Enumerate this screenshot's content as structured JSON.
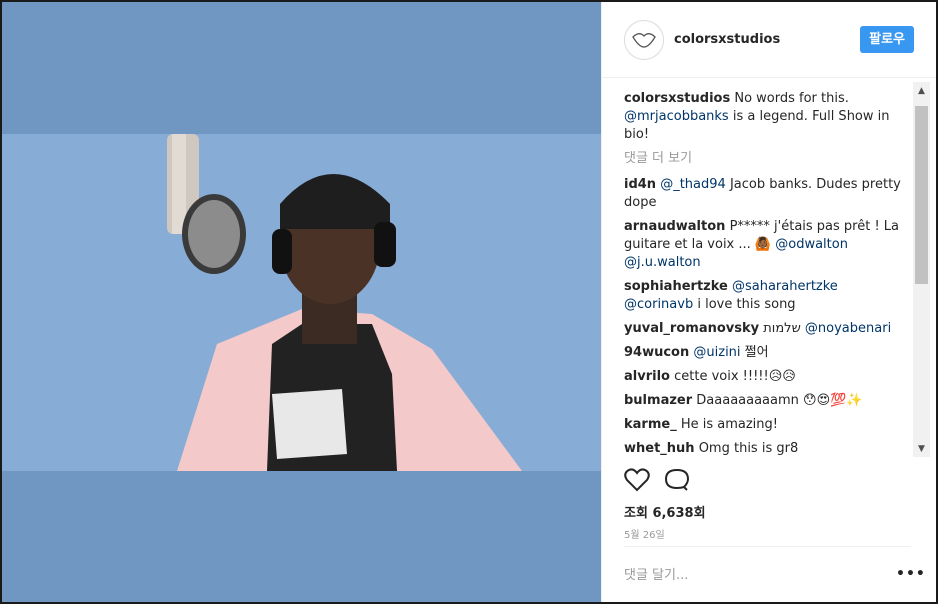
{
  "header": {
    "handle": "colorsxstudios",
    "follow_label": "팔로우"
  },
  "caption": {
    "user": "colorsxstudios",
    "text": "No words for this.",
    "mention": "@mrjacobbanks",
    "text2": "is a legend. Full Show in bio!"
  },
  "more_comments": "댓글 더 보기",
  "comments": [
    {
      "user": "id4n",
      "mention": "@_thad94",
      "text": "Jacob banks. Dudes pretty dope"
    },
    {
      "user": "arnaudwalton",
      "text": "P***** j'étais pas prêt ! La guitare et la voix ... 🙆🏾",
      "mention": "@odwalton",
      "mention2": "@j.u.walton"
    },
    {
      "user": "sophiahertzke",
      "mention": "@saharahertzke",
      "mention2": "@corinavb",
      "text": "i love this song"
    },
    {
      "user": "yuval_romanovsky",
      "text": "שלמות",
      "mention": "@noyabenari"
    },
    {
      "user": "94wucon",
      "mention": "@uizini",
      "text": "쩔어"
    },
    {
      "user": "alvrilo",
      "text": "cette voix !!!!!😥😥"
    },
    {
      "user": "bulmazer",
      "text": "Daaaaaaaaamn 😯😍💯✨"
    },
    {
      "user": "karme_",
      "text": "He is amazing!"
    },
    {
      "user": "whet_huh",
      "text": "Omg this is gr8"
    }
  ],
  "views": "조회 6,638회",
  "date": "5월 26일",
  "add_comment_placeholder": "댓글 달기...",
  "options_label": "•••"
}
